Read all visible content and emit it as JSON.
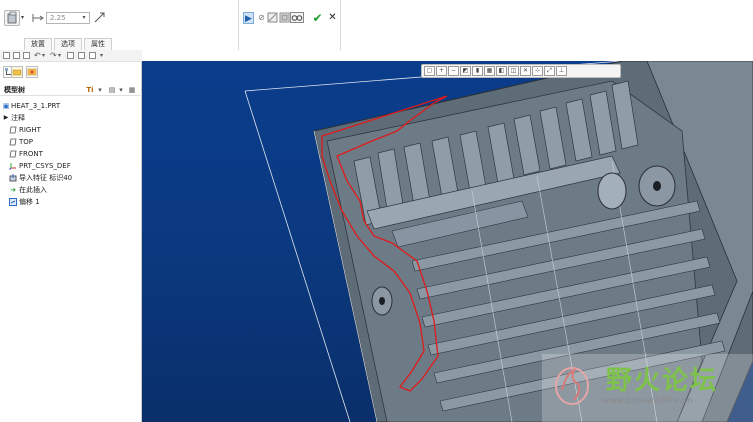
{
  "dashboard": {
    "depth_value": "2.25",
    "tabs": [
      {
        "label": "放置"
      },
      {
        "label": "选项"
      },
      {
        "label": "属性"
      }
    ],
    "icons": {
      "solid": "extrude-solid-icon",
      "depth": "depth-blind-icon",
      "flip": "flip-direction-icon",
      "play": "play-icon",
      "pause": "pause-icon",
      "preview": "preview-icon",
      "glasses": "verify-glasses-icon",
      "ok": "checkmark-icon",
      "cancel": "close-icon"
    },
    "colors": {
      "ok": "#1f9c2a",
      "play_active": "#cfe3f7"
    }
  },
  "model_tree": {
    "title": "模型树",
    "items": [
      {
        "label": "HEAT_3_1.PRT",
        "icon": "part-icon"
      },
      {
        "label": "注释",
        "icon": "expand-triangle-icon"
      },
      {
        "label": "RIGHT",
        "icon": "datum-plane-icon"
      },
      {
        "label": "TOP",
        "icon": "datum-plane-icon"
      },
      {
        "label": "FRONT",
        "icon": "datum-plane-icon"
      },
      {
        "label": "PRT_CSYS_DEF",
        "icon": "csys-icon"
      },
      {
        "label": "导入特征 标识40",
        "icon": "import-feature-icon"
      },
      {
        "label": "在此插入",
        "icon": "insert-here-arrow-icon"
      },
      {
        "label": "偏移 1",
        "icon": "offset-feature-icon"
      }
    ]
  },
  "viewport": {
    "background_colors": [
      "#0a3d8c",
      "#0a2f6a"
    ],
    "model_color": "#6f7f8c",
    "sketch_color": "#e01a1a"
  },
  "watermark": {
    "title": "野火论坛",
    "url": "www.proewildfire.cn"
  }
}
